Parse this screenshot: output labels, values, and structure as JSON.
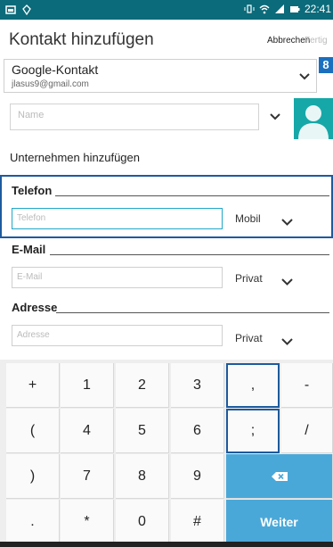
{
  "status_bar": {
    "time": "22:41"
  },
  "header": {
    "title": "Kontakt hinzufügen",
    "cancel_label": "Abbrechen",
    "done_label": "Fertig"
  },
  "account": {
    "name": "Google-Kontakt",
    "email": "jlasus9@gmail.com",
    "badge": "8"
  },
  "name_field": {
    "placeholder": "Name"
  },
  "add_company_label": "Unternehmen hinzufügen",
  "sections": {
    "phone": {
      "label": "Telefon",
      "placeholder": "Telefon",
      "type": "Mobil"
    },
    "email": {
      "label": "E-Mail",
      "placeholder": "E-Mail",
      "type": "Privat"
    },
    "address": {
      "label": "Adresse",
      "placeholder": "Adresse",
      "type": "Privat"
    }
  },
  "keyboard": {
    "keys": [
      [
        "+",
        "1",
        "2",
        "3",
        ",",
        "-"
      ],
      [
        "(",
        "4",
        "5",
        "6",
        ";",
        "/"
      ],
      [
        ")",
        "7",
        "8",
        "9",
        "backspace"
      ],
      [
        ".",
        "*",
        "0",
        "#",
        "Weiter"
      ]
    ],
    "enter_label": "Weiter"
  },
  "colors": {
    "status_bar": "#0b6b7a",
    "focus_border": "#1e5a9e",
    "accent_blue": "#4aa8d8",
    "avatar_teal": "#16a8a8"
  }
}
